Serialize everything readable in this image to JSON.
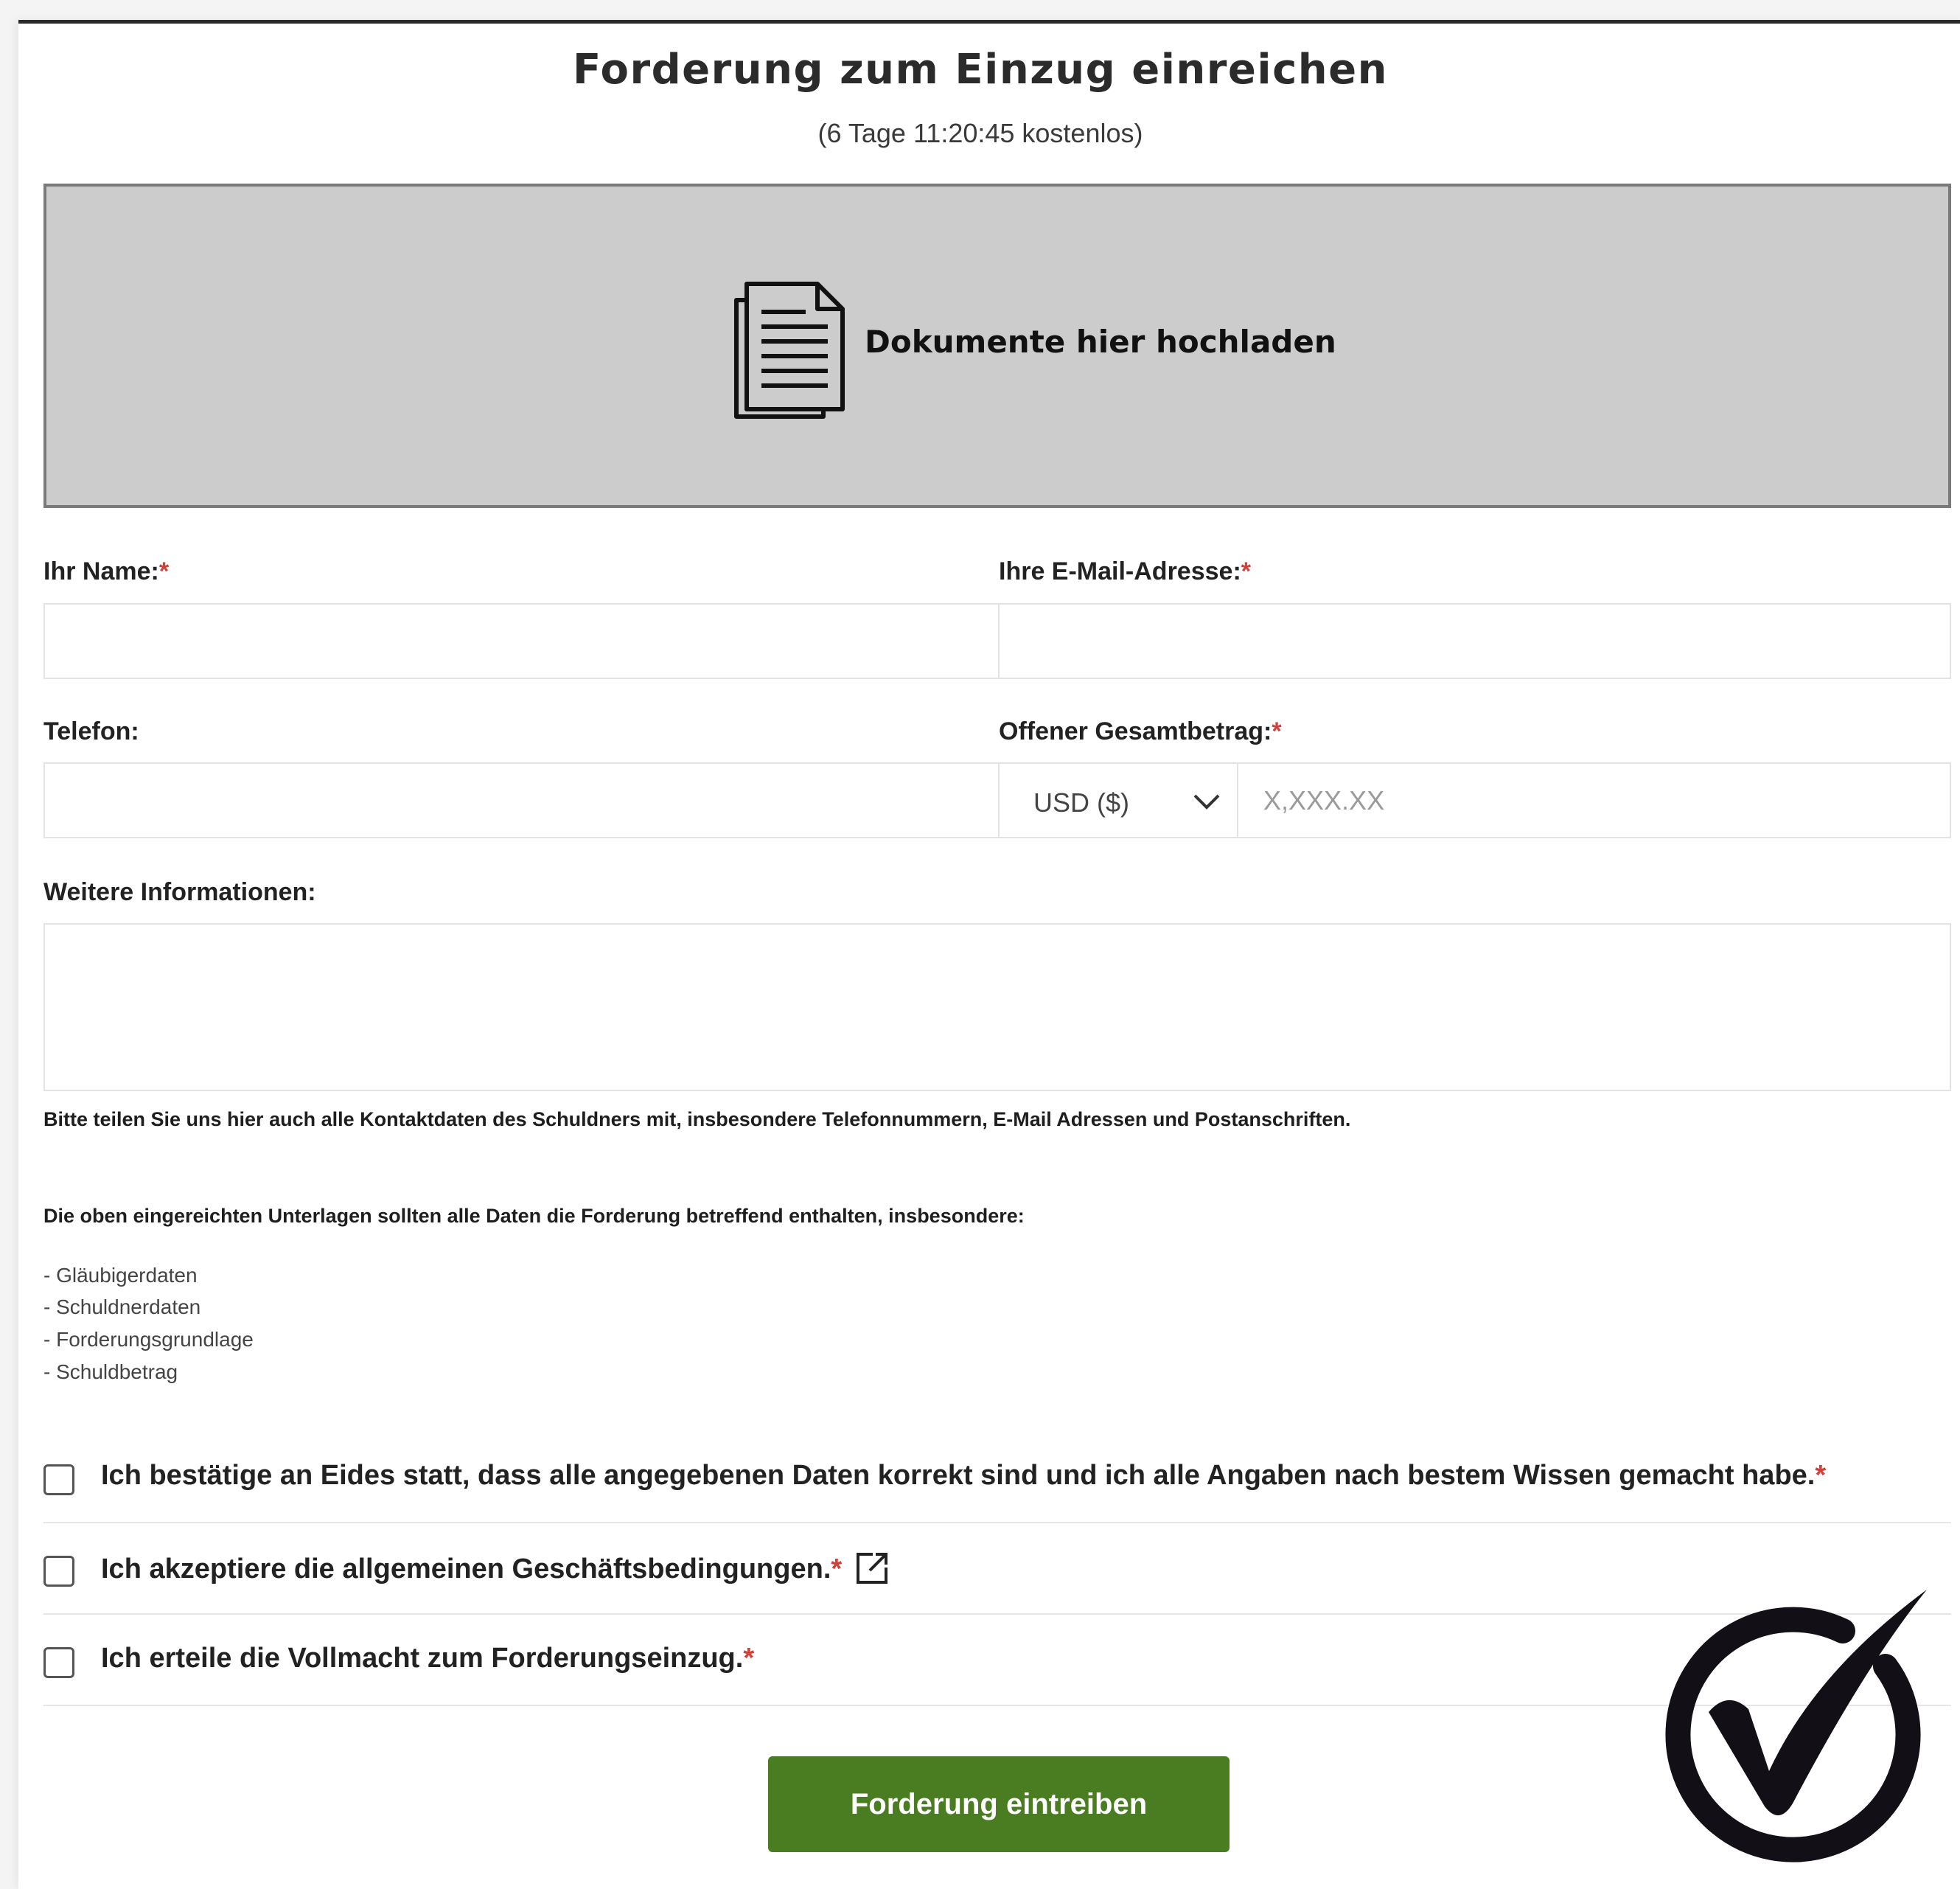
{
  "header": {
    "title": "Forderung zum Einzug einreichen",
    "subtitle": "(6 Tage 11:20:45 kostenlos)"
  },
  "upload": {
    "label": "Dokumente hier hochladen",
    "icon": "document-icon"
  },
  "form": {
    "name_label": "Ihr Name:",
    "email_label": "Ihre E-Mail-Adresse:",
    "phone_label": "Telefon:",
    "amount_label": "Offener Gesamtbetrag:",
    "required_marker": "*",
    "currency_value": "USD ($)",
    "amount_placeholder": "X,XXX.XX",
    "info_label": "Weitere Informationen:"
  },
  "notes": {
    "contact_hint": "Bitte teilen Sie uns hier auch alle Kontaktdaten des Schuldners mit, insbesondere Telefonnummern, E-Mail Adressen und Postanschriften.",
    "documents_hint": "Die oben eingereichten Unterlagen sollten alle Daten die Forderung betreffend enthalten, insbesondere:",
    "items": [
      "- Gläubigerdaten",
      "- Schuldnerdaten",
      "- Forderungsgrundlage",
      "- Schuldbetrag"
    ]
  },
  "checkboxes": {
    "oath": "Ich bestätige an Eides statt, dass alle angegebenen Daten korrekt sind und ich alle Angaben nach bestem Wissen gemacht habe.",
    "terms": "Ich akzeptiere die allgemeinen Geschäftsbedingungen.",
    "authority": "Ich erteile die Vollmacht zum Forderungseinzug."
  },
  "submit_label": "Forderung eintreiben",
  "colors": {
    "accent": "#4a7d22",
    "required": "#d0413a",
    "upload_bg": "#cccccc"
  }
}
